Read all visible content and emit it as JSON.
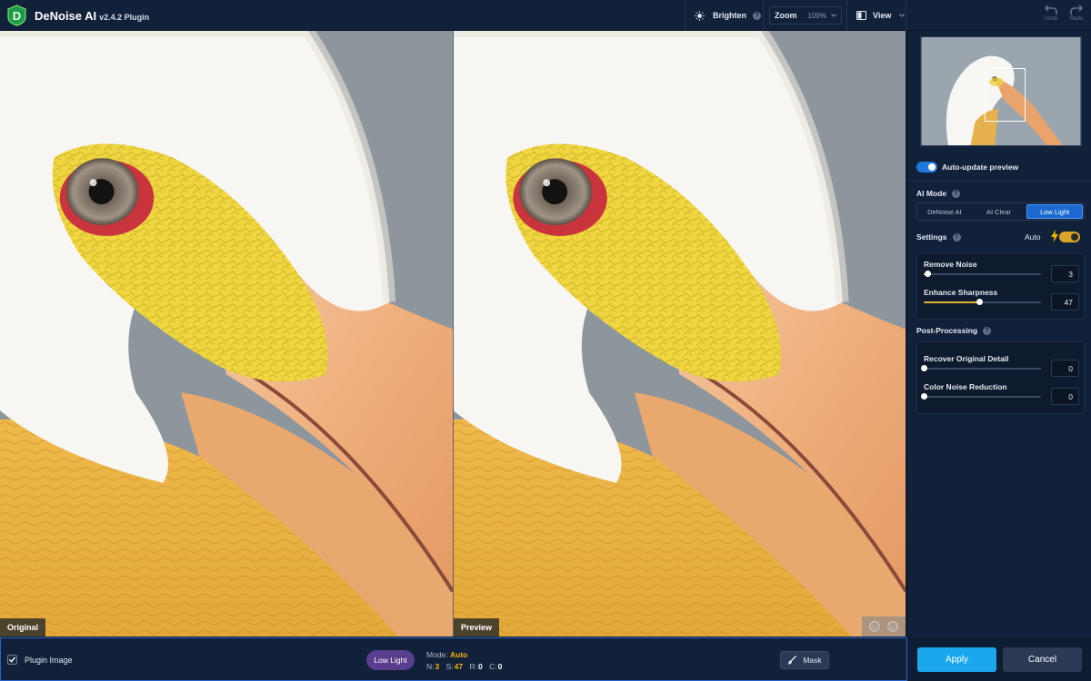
{
  "app": {
    "title": "DeNoise AI",
    "version": "v2.4.2 Plugin",
    "logo_letter": "D"
  },
  "toolbar": {
    "brighten_label": "Brighten",
    "help_glyph": "?",
    "zoom_label": "Zoom",
    "zoom_value": "100%",
    "view_label": "View",
    "undo_label": "Undo",
    "redo_label": "Redo"
  },
  "panes": {
    "left_label": "Original",
    "right_label": "Preview"
  },
  "panel": {
    "auto_update": {
      "label": "Auto-update preview",
      "on": true
    },
    "ai_mode": {
      "title": "AI Mode",
      "options": [
        "DeNoise AI",
        "AI Clear",
        "Low Light"
      ],
      "selected": "Low Light"
    },
    "settings": {
      "title": "Settings",
      "auto_label": "Auto",
      "auto_on": true,
      "sliders": [
        {
          "label": "Remove Noise",
          "value": "3",
          "level": 0.03
        },
        {
          "label": "Enhance Sharpness",
          "value": "47",
          "level": 0.47
        }
      ]
    },
    "post_processing": {
      "title": "Post-Processing",
      "sliders": [
        {
          "label": "Recover Original Detail",
          "value": "0",
          "level": 0.0
        },
        {
          "label": "Color Noise Reduction",
          "value": "0",
          "level": 0.0
        }
      ]
    }
  },
  "bottom": {
    "plugin_image_label": "Plugin Image",
    "plugin_image_checked": true,
    "mode_badge": "Low Light",
    "mode_prefix": "Mode:",
    "mode_value": "Auto",
    "stats": [
      {
        "key": "N:",
        "value": "3"
      },
      {
        "key": "S:",
        "value": "47"
      },
      {
        "key": "R:",
        "value": "0"
      },
      {
        "key": "C:",
        "value": "0"
      }
    ],
    "mask_label": "Mask",
    "apply_label": "Apply",
    "cancel_label": "Cancel"
  },
  "colors": {
    "background": "#0f1d33",
    "panel": "#12213a",
    "accent_blue": "#1aa7ee",
    "selected_mode": "#1c6ad1",
    "slider_fill": "#e3b236",
    "mode_badge": "#5a3e8e",
    "highlight": "#f0b400"
  },
  "icons": {
    "logo": "denoise-logo-icon",
    "brighten": "sun-icon",
    "view": "split-view-icon",
    "undo": "undo-arrow-icon",
    "redo": "redo-arrow-icon",
    "compare": "face-compare-icon",
    "bolt": "lightning-bolt-icon",
    "mask": "brush-icon",
    "check": "checkmark-icon"
  }
}
